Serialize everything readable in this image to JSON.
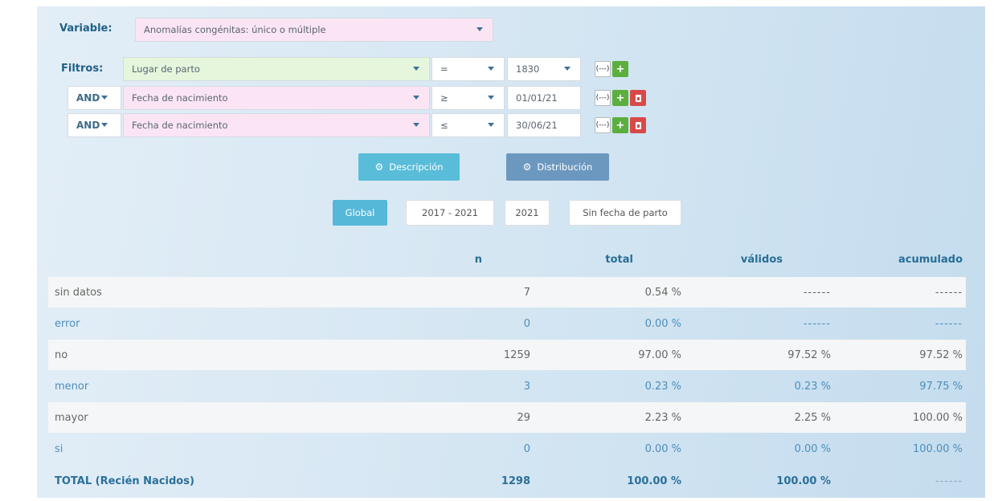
{
  "variable": {
    "label": "Variable:",
    "value": "Anomalías congénitas: único o múltiple"
  },
  "filters": {
    "label": "Filtros:",
    "rows": [
      {
        "field": "Lugar de parto",
        "op": "=",
        "value": "1830"
      },
      {
        "conj": "AND",
        "field": "Fecha de nacimiento",
        "op": "≥",
        "value": "01/01/21"
      },
      {
        "conj": "AND",
        "field": "Fecha de nacimiento",
        "op": "≤",
        "value": "30/06/21"
      }
    ],
    "bracket_glyph": "(---)",
    "add_glyph": "+"
  },
  "actions": {
    "description": "Descripción",
    "distribution": "Distribución",
    "gear_glyph": "⚙"
  },
  "tabs": [
    "Global",
    "2017 - 2021",
    "2021",
    "Sin fecha de parto"
  ],
  "active_tab": "Global",
  "table": {
    "headers": {
      "n": "n",
      "total": "total",
      "validos": "válidos",
      "acumulado": "acumulado"
    },
    "rows": [
      {
        "label": "sin datos",
        "n": "7",
        "total": "0.54 %",
        "validos": "------",
        "acumulado": "------"
      },
      {
        "label": "error",
        "n": "0",
        "total": "0.00 %",
        "validos": "------",
        "acumulado": "------"
      },
      {
        "label": "no",
        "n": "1259",
        "total": "97.00 %",
        "validos": "97.52 %",
        "acumulado": "97.52 %"
      },
      {
        "label": "menor",
        "n": "3",
        "total": "0.23 %",
        "validos": "0.23 %",
        "acumulado": "97.75 %"
      },
      {
        "label": "mayor",
        "n": "29",
        "total": "2.23 %",
        "validos": "2.25 %",
        "acumulado": "100.00 %"
      },
      {
        "label": "si",
        "n": "0",
        "total": "0.00 %",
        "validos": "0.00 %",
        "acumulado": "100.00 %"
      }
    ],
    "total_row": {
      "label": "TOTAL (Recién Nacidos)",
      "n": "1298",
      "total": "100.00 %",
      "validos": "100.00 %",
      "acumulado": "------"
    }
  },
  "colors": {
    "accent": "#55b8d8",
    "header_text": "#286e96",
    "pink_select": "#fbe5f4",
    "green_select": "#e5f6dc",
    "add_button": "#5cae3f",
    "delete_button": "#d84a4a"
  }
}
